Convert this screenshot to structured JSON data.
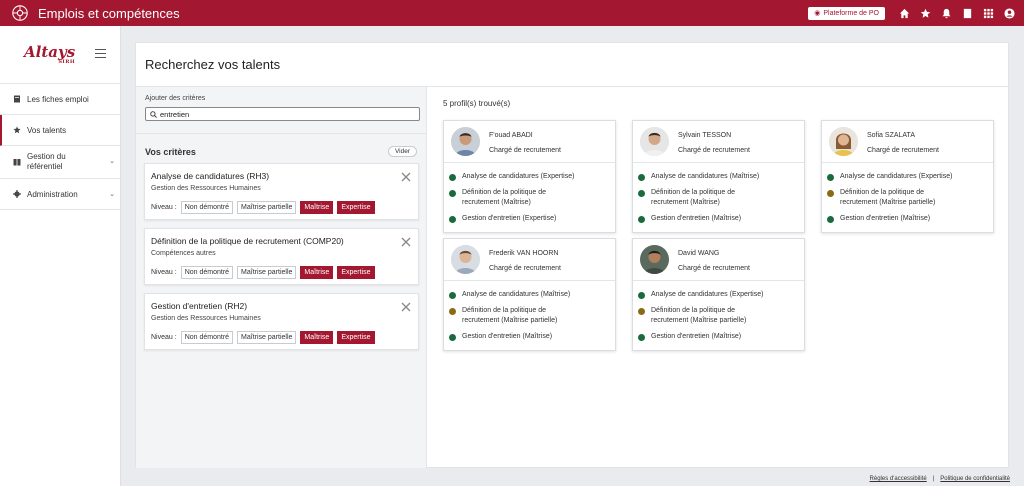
{
  "app": {
    "title": "Emplois et compétences",
    "platform_label": "Plateforme de PO"
  },
  "brand": {
    "name": "Altays",
    "sub": "SIRH"
  },
  "sidebar": {
    "items": [
      {
        "label": "Les fiches emploi",
        "icon": "book-icon"
      },
      {
        "label": "Vos talents",
        "icon": "star-icon"
      },
      {
        "label": "Gestion du référentiel",
        "line1": "Gestion du",
        "line2": "référentiel",
        "icon": "book-open-icon"
      },
      {
        "label": "Administration",
        "icon": "gear-icon"
      }
    ]
  },
  "main": {
    "title": "Recherchez vos talents",
    "criteria_label": "Ajouter des critères",
    "search_value": "entretien",
    "vos_criteres": "Vos critères",
    "vider": "Vider",
    "niveau_label": "Niveau :",
    "levels": [
      "Non démontré",
      "Maîtrise partielle",
      "Maîtrise",
      "Expertise"
    ],
    "criteria": [
      {
        "title": "Analyse de candidatures (RH3)",
        "subtitle": "Gestion des Ressources Humaines"
      },
      {
        "title": "Définition de la politique de recrutement (COMP20)",
        "subtitle": "Compétences autres"
      },
      {
        "title": "Gestion d'entretien (RH2)",
        "subtitle": "Gestion des Ressources Humaines"
      }
    ],
    "results_count": "5 profil(s) trouvé(s)",
    "profiles": [
      {
        "name": "F'ouad ABADI",
        "role": "Chargé de recrutement",
        "skills": [
          {
            "line1": "Analyse de candidatures (Expertise)",
            "line2": "",
            "color": "#1a6b3c"
          },
          {
            "line1": "Définition de la politique de",
            "line2": "recrutement (Maîtrise)",
            "color": "#1a6b3c"
          },
          {
            "line1": "Gestion d'entretien (Expertise)",
            "line2": "",
            "color": "#1a6b3c"
          }
        ]
      },
      {
        "name": "Sylvain TESSON",
        "role": "Chargé de recrutement",
        "skills": [
          {
            "line1": "Analyse de candidatures (Maîtrise)",
            "line2": "",
            "color": "#1a6b3c"
          },
          {
            "line1": "Définition de la politique de",
            "line2": "recrutement (Maîtrise)",
            "color": "#1a6b3c"
          },
          {
            "line1": "Gestion d'entretien (Maîtrise)",
            "line2": "",
            "color": "#1a6b3c"
          }
        ]
      },
      {
        "name": "Sofia SZALATA",
        "role": "Chargé de recrutement",
        "skills": [
          {
            "line1": "Analyse de candidatures (Expertise)",
            "line2": "",
            "color": "#1a6b3c"
          },
          {
            "line1": "Définition de la politique de",
            "line2": "recrutement (Maîtrise partielle)",
            "color": "#8a6a12"
          },
          {
            "line1": "Gestion d'entretien (Maîtrise)",
            "line2": "",
            "color": "#1a6b3c"
          }
        ]
      },
      {
        "name": "Frederik VAN HOORN",
        "role": "Chargé de recrutement",
        "skills": [
          {
            "line1": "Analyse de candidatures (Maîtrise)",
            "line2": "",
            "color": "#1a6b3c"
          },
          {
            "line1": "Définition de la politique de",
            "line2": "recrutement (Maîtrise partielle)",
            "color": "#8a6a12"
          },
          {
            "line1": "Gestion d'entretien (Maîtrise)",
            "line2": "",
            "color": "#1a6b3c"
          }
        ]
      },
      {
        "name": "David WANG",
        "role": "Chargé de recrutement",
        "skills": [
          {
            "line1": "Analyse de candidatures (Expertise)",
            "line2": "",
            "color": "#1a6b3c"
          },
          {
            "line1": "Définition de la politique de",
            "line2": "recrutement (Maîtrise partielle)",
            "color": "#8a6a12"
          },
          {
            "line1": "Gestion d'entretien (Maîtrise)",
            "line2": "",
            "color": "#1a6b3c"
          }
        ]
      }
    ]
  },
  "footer": {
    "accessibility": "Règles d'accessibilité",
    "separator": "|",
    "privacy": "Politique de confidentialité"
  },
  "colors": {
    "brand": "#a31830",
    "skill_ok": "#1a6b3c",
    "skill_partial": "#8a6a12"
  }
}
